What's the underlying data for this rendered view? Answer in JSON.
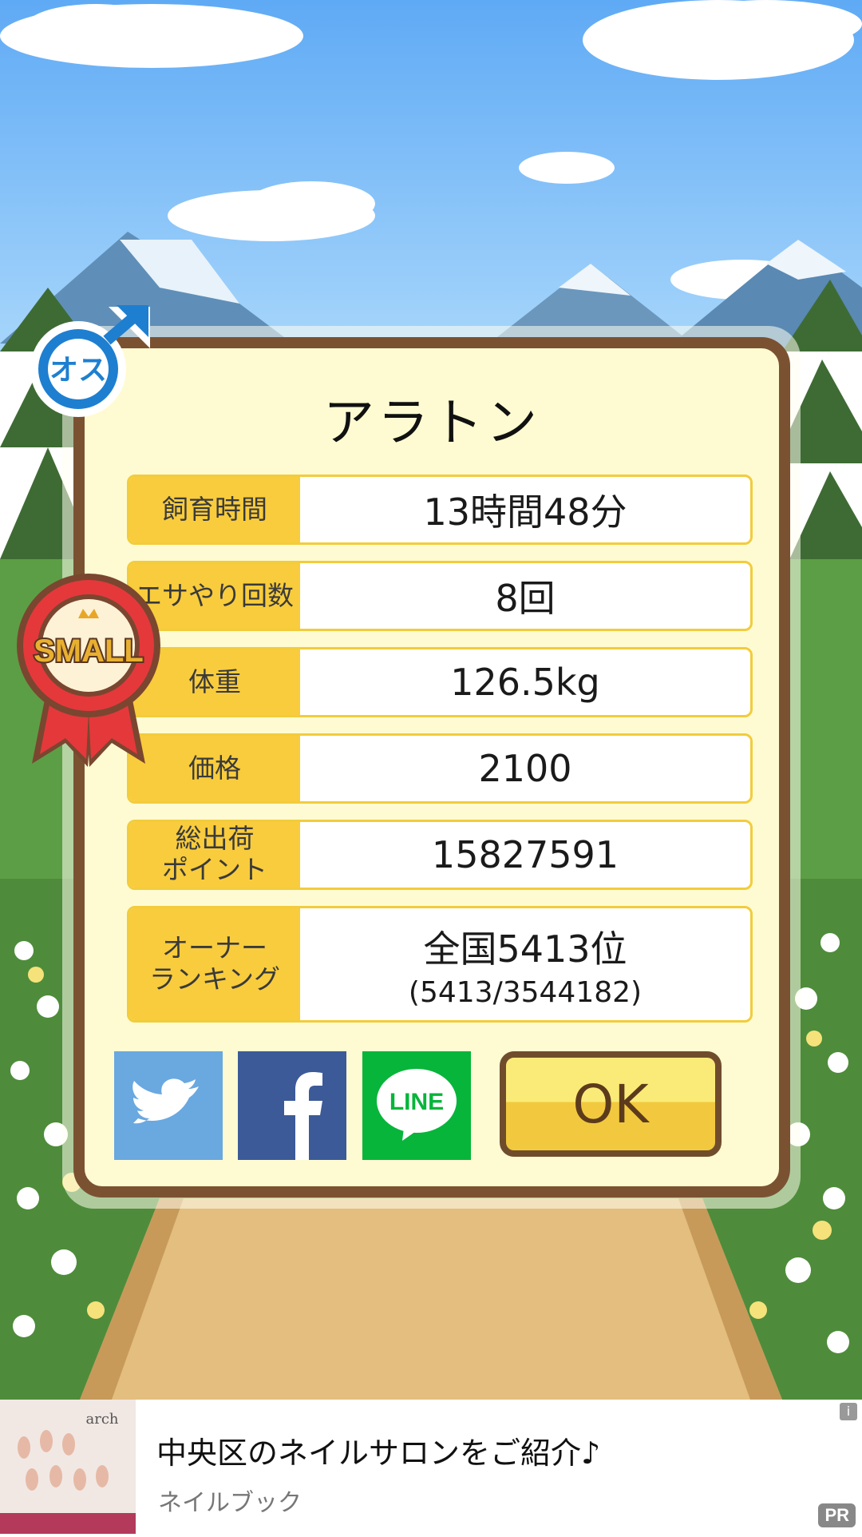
{
  "pig": {
    "name": "アラトン",
    "gender_badge": "オス",
    "size_badge": "SMALL"
  },
  "stats": [
    {
      "label": "飼育時間",
      "value": "13時間48分"
    },
    {
      "label": "エサやり回数",
      "value": "8回"
    },
    {
      "label": "体重",
      "value": "126.5kg"
    },
    {
      "label": "価格",
      "value": "2100"
    },
    {
      "label": "総出荷\nポイント",
      "value": "15827591"
    },
    {
      "label": "オーナー\nランキング",
      "value": "全国5413位",
      "sub": "(5413/3544182)"
    }
  ],
  "buttons": {
    "twitter_icon": "twitter-bird-icon",
    "facebook_icon": "facebook-f-icon",
    "line_label": "LINE",
    "ok_label": "OK"
  },
  "ad": {
    "brand_text": "arch",
    "title": "中央区のネイルサロンをご紹介♪",
    "subtitle": "ネイルブック",
    "info": "i",
    "pr": "PR"
  },
  "colors": {
    "card_bg": "#fefbd2",
    "card_border": "#7a5232",
    "label_bg": "#f8cc3c",
    "twitter": "#6aa8e0",
    "facebook": "#3c5a98",
    "line": "#07b53b",
    "male_blue": "#1e7fd0",
    "ribbon_red": "#e5383b"
  }
}
